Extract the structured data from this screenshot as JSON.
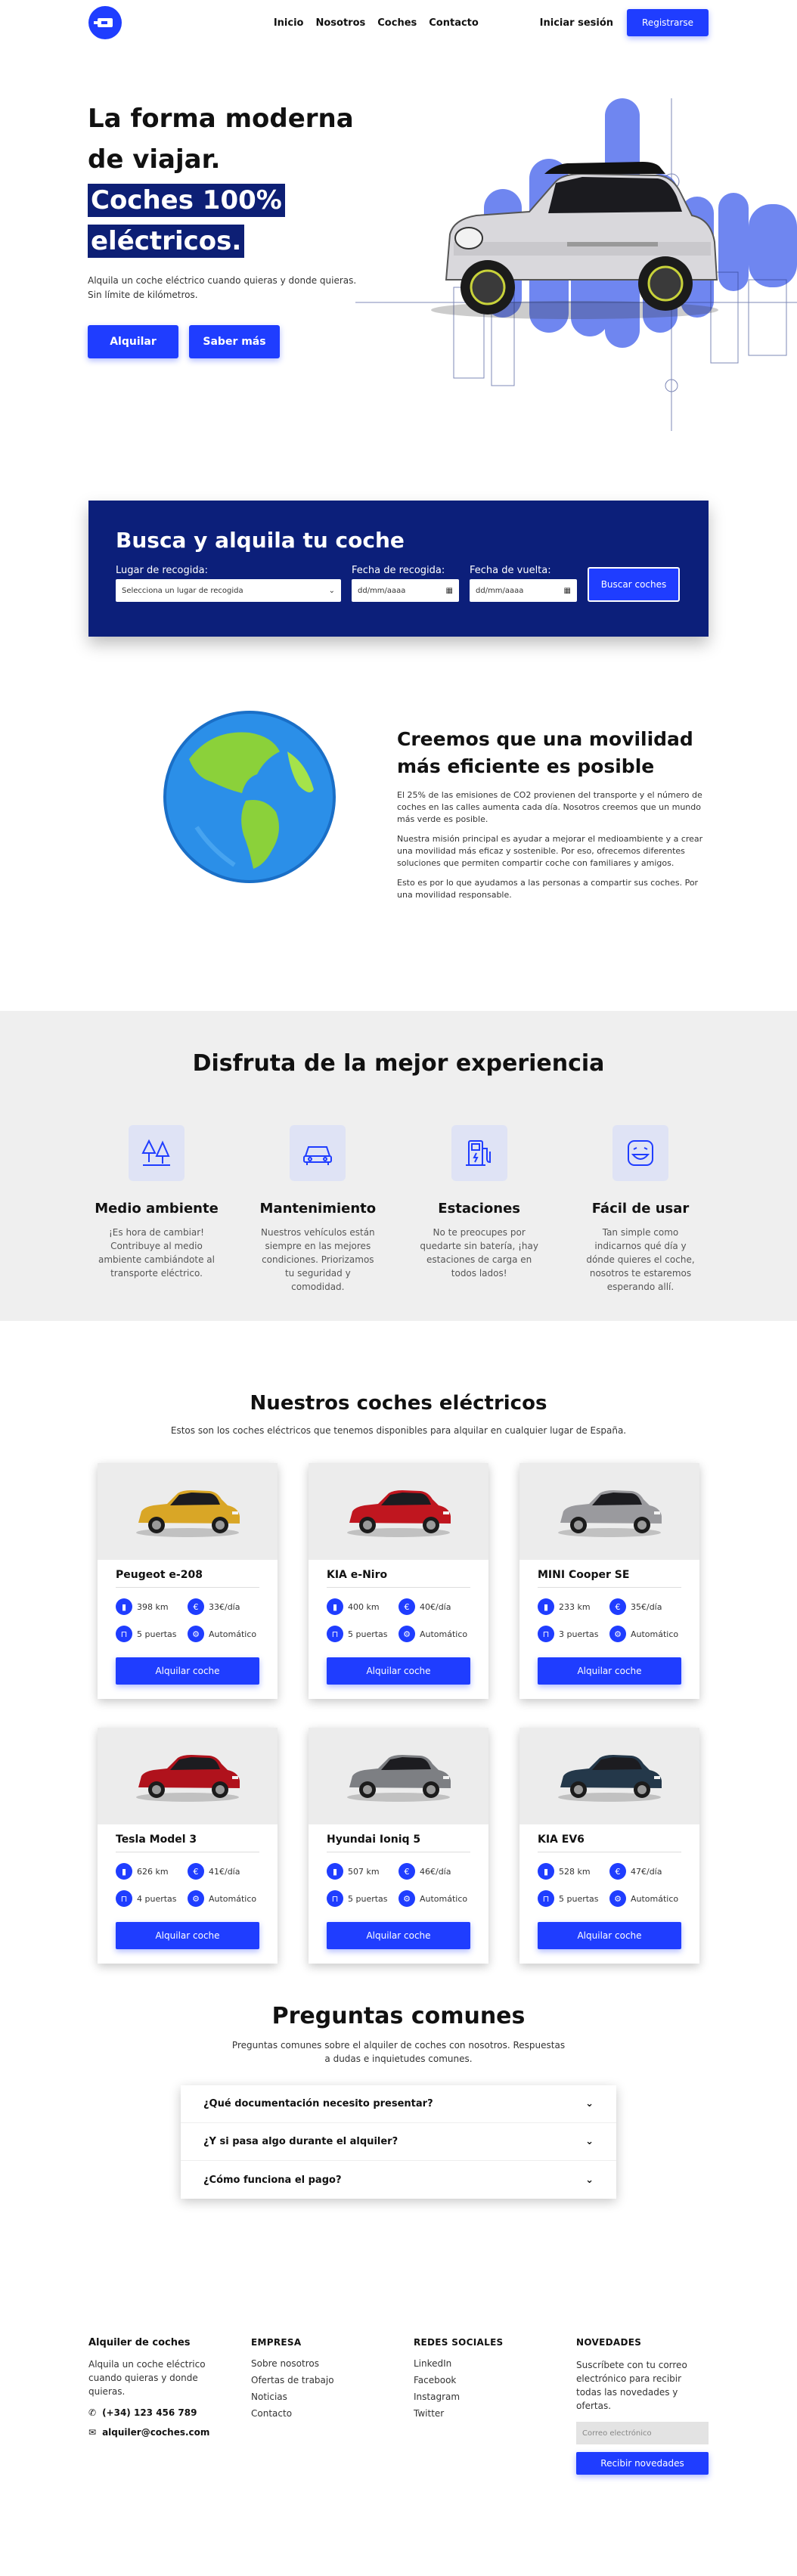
{
  "nav": {
    "links": [
      "Inicio",
      "Nosotros",
      "Coches",
      "Contacto"
    ],
    "login": "Iniciar sesión",
    "register": "Registrarse"
  },
  "hero": {
    "line1": "La forma moderna",
    "line2": "de viajar.",
    "hl1": "Coches 100%",
    "hl2": "eléctricos.",
    "subtitle": "Alquila un coche eléctrico cuando quieras y donde quieras. Sin límite de kilómetros.",
    "btn_rent": "Alquilar",
    "btn_more": "Saber más"
  },
  "search": {
    "title": "Busca y alquila tu coche",
    "pickup_label": "Lugar de recogida:",
    "pickup_placeholder": "Selecciona un lugar de recogida",
    "date_pick_label": "Fecha de recogida:",
    "date_return_label": "Fecha de vuelta:",
    "date_placeholder": "dd/mm/aaaa",
    "button": "Buscar coches"
  },
  "about": {
    "title": "Creemos que una movilidad más eficiente es posible",
    "p1": "El 25% de las emisiones de CO2 provienen del transporte y el número de coches en las calles aumenta cada día. Nosotros creemos que un mundo más verde es posible.",
    "p2": "Nuestra misión principal es ayudar a mejorar el medioambiente y a crear una movilidad más eficaz y sostenible. Por eso, ofrecemos diferentes soluciones que permiten compartir coche con familiares y amigos.",
    "p3": "Esto es por lo que ayudamos a las personas a compartir sus coches. Por una movilidad responsable."
  },
  "experience": {
    "title": "Disfruta de la mejor experiencia",
    "items": [
      {
        "icon": "trees-icon",
        "title": "Medio ambiente",
        "text": "¡Es hora de cambiar! Contribuye al medio ambiente cambiándote al transporte eléctrico."
      },
      {
        "icon": "car-icon",
        "title": "Mantenimiento",
        "text": "Nuestros vehículos están siempre en las mejores condiciones. Priorizamos tu seguridad y comodidad."
      },
      {
        "icon": "charging-station-icon",
        "title": "Estaciones",
        "text": "No te preocupes por quedarte sin batería, ¡hay estaciones de carga en todos lados!"
      },
      {
        "icon": "smile-icon",
        "title": "Fácil de usar",
        "text": "Tan simple como indicarnos qué día y dónde quieres el coche, nosotros te estaremos esperando allí."
      }
    ]
  },
  "cars": {
    "title": "Nuestros coches eléctricos",
    "subtitle": "Estos son los coches eléctricos que tenemos disponibles para alquilar en cualquier lugar de España.",
    "button": "Alquilar coche",
    "items": [
      {
        "name": "Peugeot e-208",
        "range": "398 km",
        "price": "33€/día",
        "doors": "5 puertas",
        "gear": "Automático",
        "color": "#d9a626"
      },
      {
        "name": "KIA e-Niro",
        "range": "400 km",
        "price": "40€/día",
        "doors": "5 puertas",
        "gear": "Automático",
        "color": "#c0161f"
      },
      {
        "name": "MINI Cooper SE",
        "range": "233 km",
        "price": "35€/día",
        "doors": "3 puertas",
        "gear": "Automático",
        "color": "#9a9a9e"
      },
      {
        "name": "Tesla Model 3",
        "range": "626 km",
        "price": "41€/día",
        "doors": "4 puertas",
        "gear": "Automático",
        "color": "#b0121c"
      },
      {
        "name": "Hyundai Ioniq 5",
        "range": "507 km",
        "price": "46€/día",
        "doors": "5 puertas",
        "gear": "Automático",
        "color": "#7d7f83"
      },
      {
        "name": "KIA EV6",
        "range": "528 km",
        "price": "47€/día",
        "doors": "5 puertas",
        "gear": "Automático",
        "color": "#24384a"
      }
    ]
  },
  "faq": {
    "title": "Preguntas comunes",
    "subtitle": "Preguntas comunes sobre el alquiler de coches con nosotros. Respuestas a dudas e inquietudes comunes.",
    "questions": [
      "¿Qué documentación necesito presentar?",
      "¿Y si pasa algo durante el alquiler?",
      "¿Cómo funciona el pago?"
    ]
  },
  "footer": {
    "brand": "Alquiler de coches",
    "brand_text": "Alquila un coche eléctrico cuando quieras y donde quieras.",
    "phone": "(+34) 123 456 789",
    "email": "alquiler@coches.com",
    "company_title": "EMPRESA",
    "company_links": [
      "Sobre nosotros",
      "Ofertas de trabajo",
      "Noticias",
      "Contacto"
    ],
    "social_title": "REDES SOCIALES",
    "social_links": [
      "LinkedIn",
      "Facebook",
      "Instagram",
      "Twitter"
    ],
    "news_title": "NOVEDADES",
    "news_text": "Suscríbete con tu correo electrónico para recibir todas las novedades y ofertas.",
    "news_placeholder": "Correo electrónico",
    "news_button": "Recibir novedades"
  },
  "colors": {
    "accent": "#1f3dff",
    "navy": "#0c1f7a",
    "light_bg": "#efefef"
  }
}
